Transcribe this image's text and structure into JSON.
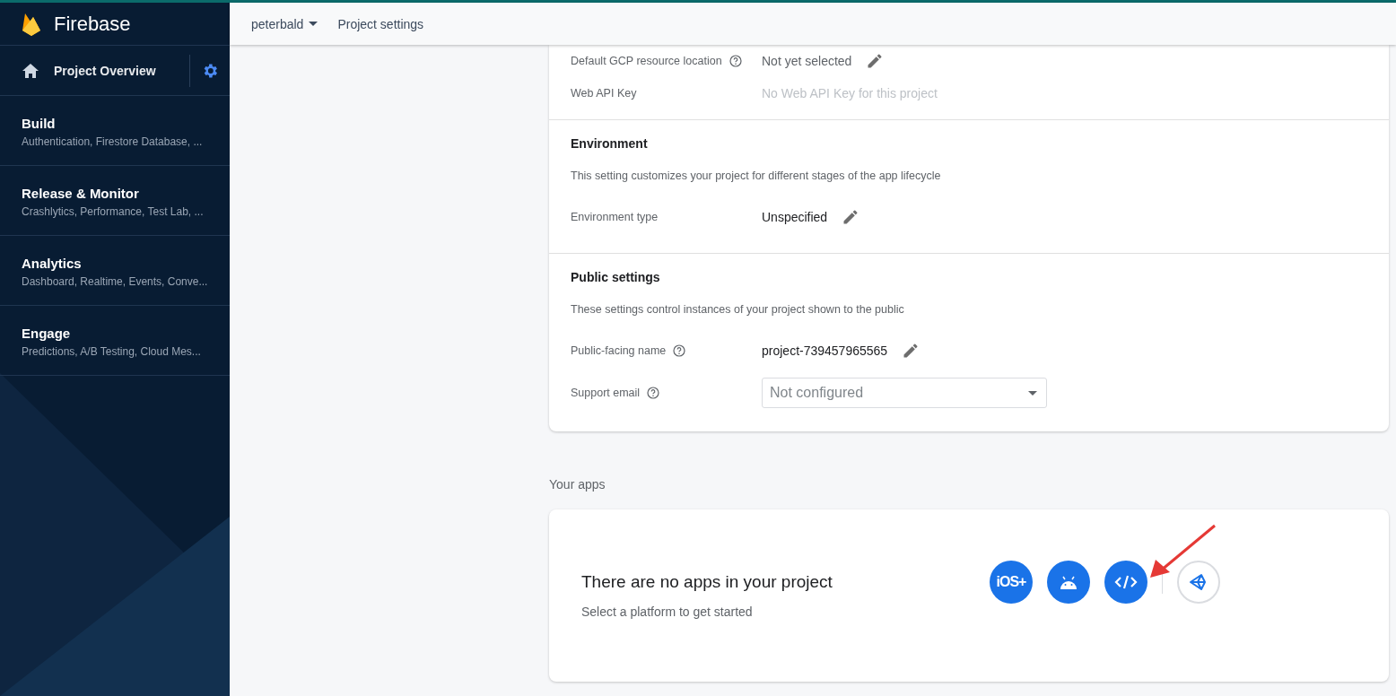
{
  "sidebar": {
    "brand": "Firebase",
    "overview": {
      "label": "Project Overview"
    },
    "categories": [
      {
        "title": "Build",
        "subtitle": "Authentication, Firestore Database, ..."
      },
      {
        "title": "Release & Monitor",
        "subtitle": "Crashlytics, Performance, Test Lab, ..."
      },
      {
        "title": "Analytics",
        "subtitle": "Dashboard, Realtime, Events, Conve..."
      },
      {
        "title": "Engage",
        "subtitle": "Predictions, A/B Testing, Cloud Mes..."
      }
    ]
  },
  "header": {
    "project": "peterbald",
    "page": "Project settings"
  },
  "settings_top": [
    {
      "kind": "text",
      "label": "Default GCP resource location",
      "help": true,
      "value": "Not yet selected",
      "muted": false,
      "editable": true
    },
    {
      "kind": "text",
      "label": "Web API Key",
      "help": false,
      "value": "No Web API Key for this project",
      "muted": true,
      "editable": false
    }
  ],
  "sections": [
    {
      "title": "Environment",
      "description": "This setting customizes your project for different stages of the app lifecycle",
      "rows": [
        {
          "kind": "text",
          "label": "Environment type",
          "help": false,
          "value": "Unspecified",
          "editable": true
        }
      ]
    },
    {
      "title": "Public settings",
      "description": "These settings control instances of your project shown to the public",
      "rows": [
        {
          "kind": "text",
          "label": "Public-facing name",
          "help": true,
          "value": "project-739457965565",
          "editable": true
        },
        {
          "kind": "select",
          "label": "Support email",
          "help": true,
          "placeholder": "Not configured"
        }
      ]
    }
  ],
  "your_apps": {
    "heading": "Your apps",
    "title": "There are no apps in your project",
    "subtitle": "Select a platform to get started",
    "platforms": [
      {
        "kind": "ios",
        "label": "iOS+"
      },
      {
        "kind": "android"
      },
      {
        "kind": "web"
      },
      {
        "kind": "unity"
      }
    ]
  }
}
